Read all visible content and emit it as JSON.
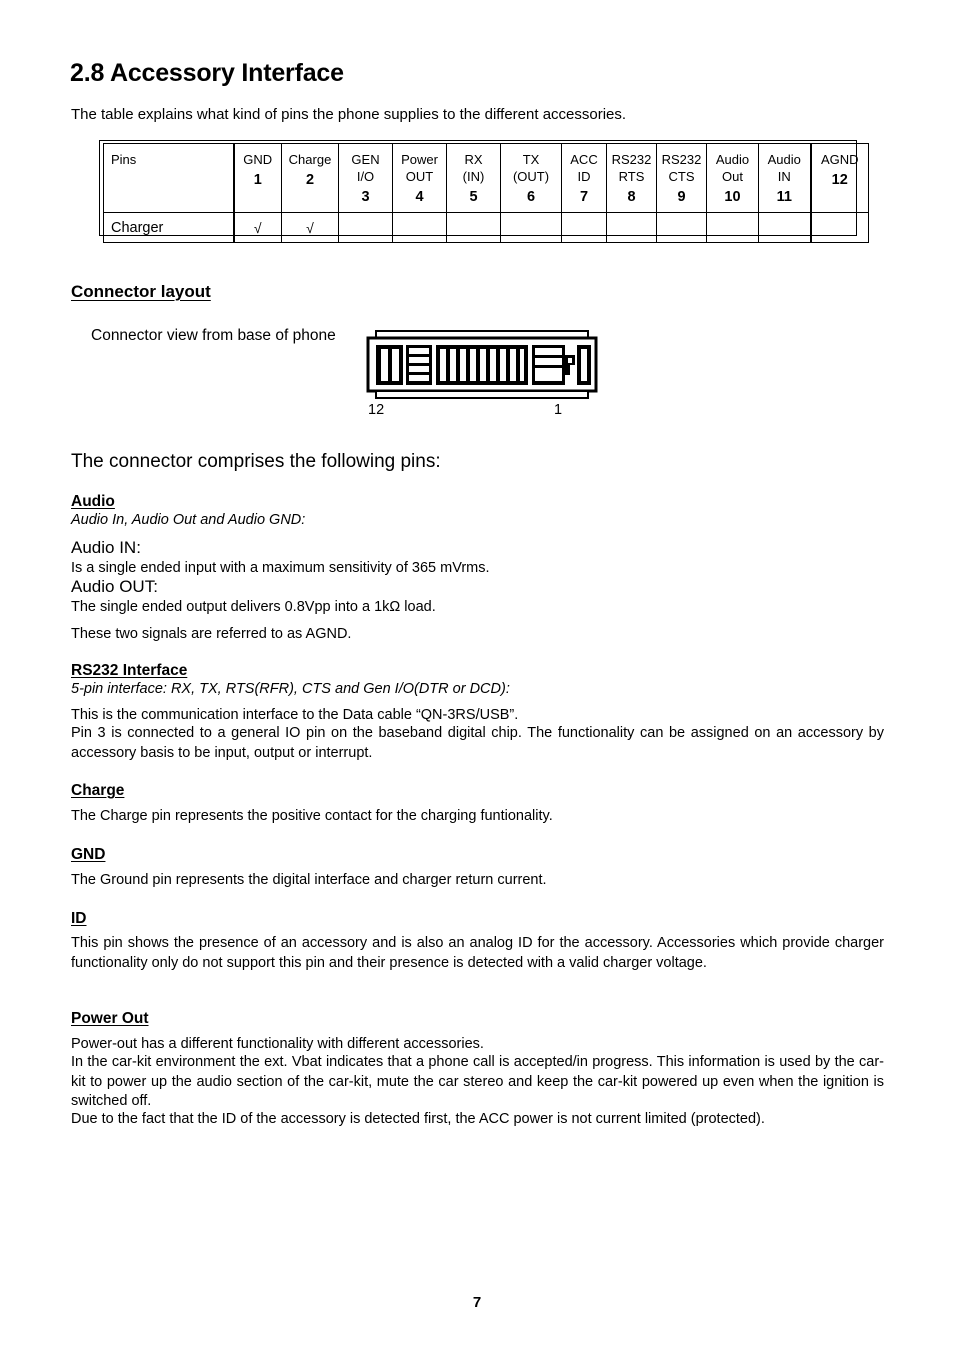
{
  "document": {
    "page_number": "7"
  },
  "section": {
    "title": "2.8 Accessory Interface",
    "intro": "The table explains what kind of pins the phone supplies to the different accessories."
  },
  "pin_table": {
    "row_label_header": "Pins",
    "row_label_charger": "Charger",
    "columns": [
      {
        "line1": "GND",
        "line2": "",
        "num": "1"
      },
      {
        "line1": "Charge",
        "line2": "",
        "num": "2"
      },
      {
        "line1": "GEN",
        "line2": "I/O",
        "num": "3"
      },
      {
        "line1": "Power",
        "line2": "OUT",
        "num": "4"
      },
      {
        "line1": "RX",
        "line2": "(IN)",
        "num": "5"
      },
      {
        "line1": "TX",
        "line2": "(OUT)",
        "num": "6"
      },
      {
        "line1": "ACC",
        "line2": "ID",
        "num": "7"
      },
      {
        "line1": "RS232",
        "line2": "RTS",
        "num": "8"
      },
      {
        "line1": "RS232",
        "line2": "CTS",
        "num": "9"
      },
      {
        "line1": "Audio",
        "line2": "Out",
        "num": "10"
      },
      {
        "line1": "Audio",
        "line2": "IN",
        "num": "11"
      },
      {
        "line1": "AGND",
        "line2": "",
        "num": "12"
      }
    ],
    "charger_row": [
      "√",
      "√",
      "",
      "",
      "",
      "",
      "",
      "",
      "",
      "",
      "",
      ""
    ]
  },
  "connector_layout": {
    "heading": "Connector layout",
    "view_caption": "Connector view from base of phone",
    "pin_left_label": "12",
    "pin_right_label": "1"
  },
  "pins_description": {
    "lead": "The connector comprises the following pins:",
    "audio": {
      "heading": "Audio",
      "subtitle": "Audio In, Audio Out and Audio GND:",
      "in_title": "Audio IN:",
      "in_text": "Is a single ended input with a maximum sensitivity of 365 mVrms.",
      "out_title": "Audio OUT:",
      "out_text": "The single ended output delivers 0.8Vpp into a 1kΩ load.",
      "note": "These two signals are referred to as AGND."
    },
    "rs232": {
      "heading": "RS232 Interface",
      "subtitle": "5-pin interface: RX, TX, RTS(RFR), CTS and Gen I/O(DTR or DCD):",
      "p1": "This is the communication interface to the Data cable “QN-3RS/USB”.",
      "p2": "Pin 3 is connected to a general IO pin on the baseband digital chip. The functionality can be assigned on an accessory by accessory basis to be input, output or interrupt."
    },
    "charge": {
      "heading": "Charge",
      "p1": "The Charge pin represents the positive contact for the charging funtionality."
    },
    "gnd": {
      "heading": "GND",
      "p1": "The Ground pin represents the digital interface and charger return current."
    },
    "id": {
      "heading": "ID",
      "p1": "This pin shows the presence of an accessory and is also an analog ID for the accessory. Accessories which provide charger functionality only do not support this pin and their presence is detected with a valid charger voltage."
    },
    "power_out": {
      "heading": "Power Out",
      "p1": "Power-out has a different functionality with different accessories.",
      "p2": "In the car-kit environment the ext. Vbat indicates that a phone call is accepted/in progress. This information is used by the car-kit to power up the audio section of the car-kit, mute the car stereo and keep the car-kit powered up even when the ignition is switched off.",
      "p3": "Due to the fact that the ID of the accessory is detected first, the ACC power is not current limited (protected)."
    }
  }
}
